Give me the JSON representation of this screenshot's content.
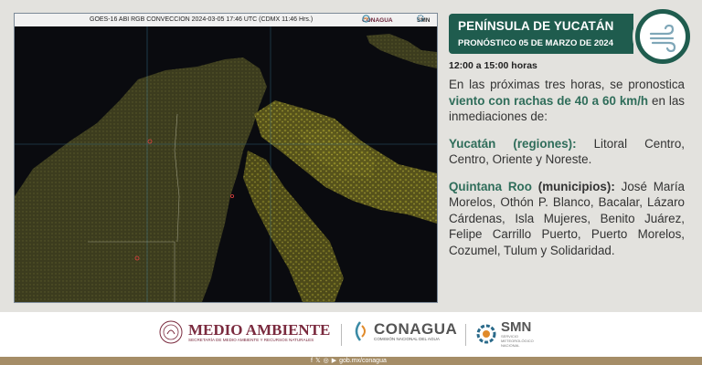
{
  "satellite": {
    "caption": "GOES-16 ABI RGB CONVECCION 2024-03-05 17:46 UTC (CDMX  11:46 Hrs.)",
    "logo_conagua": "CONAGUA",
    "logo_smn": "SMN"
  },
  "header": {
    "title": "PENÍNSULA DE YUCATÁN",
    "subtitle": "PRONÓSTICO 05 DE MARZO DE 2024",
    "icon": "wind-icon",
    "colors": {
      "primary": "#1f5c4e",
      "highlight": "#2f6d5a"
    }
  },
  "forecast": {
    "time_range": "12:00 a 15:00 horas",
    "intro_before": "En las próximas tres horas, se pronostica ",
    "intro_highlight": "viento con rachas de 40 a 60 km/h",
    "intro_after": " en las inmediaciones de:",
    "region1_label": "Yucatán (regiones):",
    "region1_text": " Litoral Centro, Centro, Oriente y Noreste.",
    "region2_label": "Quintana Roo",
    "region2_qualifier": " (municipios):",
    "region2_text": " José María Morelos, Othón P. Blanco, Bacalar, Lázaro Cárdenas, Isla Mujeres, Benito Juárez, Felipe Carrillo Puerto, Puerto Morelos, Cozumel, Tulum y Solidaridad."
  },
  "footer": {
    "medio_ambiente": "MEDIO AMBIENTE",
    "medio_ambiente_sub": "SECRETARÍA DE MEDIO AMBIENTE Y RECURSOS NATURALES",
    "conagua": "CONAGUA",
    "conagua_sub": "COMISIÓN NACIONAL DEL AGUA",
    "smn": "SMN",
    "smn_sub": "SERVICIO METEOROLÓGICO NACIONAL",
    "website": "gob.mx/conagua",
    "social_icons": [
      "facebook-icon",
      "x-icon",
      "instagram-icon",
      "youtube-icon"
    ]
  }
}
